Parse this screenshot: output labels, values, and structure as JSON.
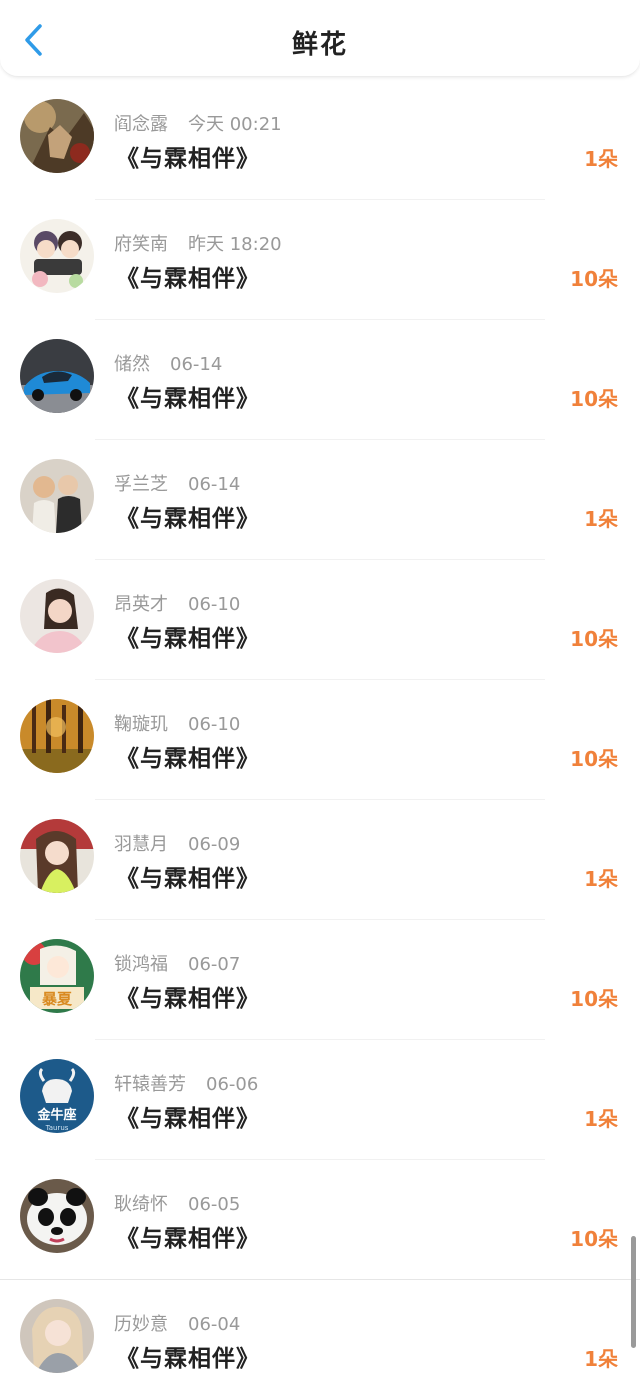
{
  "header": {
    "title": "鲜花"
  },
  "accent_color": "#f0813a",
  "items": [
    {
      "name": "阎念露",
      "time": "今天 00:21",
      "book": "《与霖相伴》",
      "amount": "1朵"
    },
    {
      "name": "府笑南",
      "time": "昨天 18:20",
      "book": "《与霖相伴》",
      "amount": "10朵"
    },
    {
      "name": "储然",
      "time": "06-14",
      "book": "《与霖相伴》",
      "amount": "10朵"
    },
    {
      "name": "孚兰芝",
      "time": "06-14",
      "book": "《与霖相伴》",
      "amount": "1朵"
    },
    {
      "name": "昂英才",
      "time": "06-10",
      "book": "《与霖相伴》",
      "amount": "10朵"
    },
    {
      "name": "鞠璇玑",
      "time": "06-10",
      "book": "《与霖相伴》",
      "amount": "10朵"
    },
    {
      "name": "羽慧月",
      "time": "06-09",
      "book": "《与霖相伴》",
      "amount": "1朵"
    },
    {
      "name": "锁鸿福",
      "time": "06-07",
      "book": "《与霖相伴》",
      "amount": "10朵"
    },
    {
      "name": "轩辕善芳",
      "time": "06-06",
      "book": "《与霖相伴》",
      "amount": "1朵"
    },
    {
      "name": "耿绮怀",
      "time": "06-05",
      "book": "《与霖相伴》",
      "amount": "10朵"
    },
    {
      "name": "历妙意",
      "time": "06-04",
      "book": "《与霖相伴》",
      "amount": "1朵"
    }
  ],
  "avatar_labels": {
    "item7": "暴夏",
    "item8": "金牛座",
    "item8_sub": "Taurus"
  }
}
